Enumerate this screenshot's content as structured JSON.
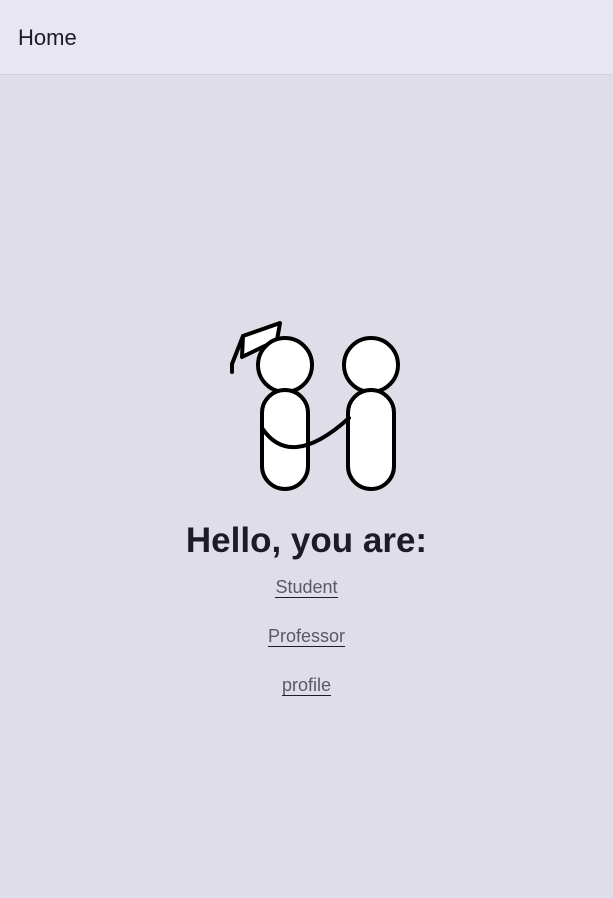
{
  "header": {
    "title": "Home"
  },
  "main": {
    "greeting": "Hello, you are:",
    "links": [
      {
        "label": "Student"
      },
      {
        "label": "Professor"
      },
      {
        "label": "profile"
      }
    ]
  },
  "colors": {
    "background": "#dfdee8",
    "header_background": "#e7e6f1",
    "text": "#1d1b26",
    "link_text": "#5a5866"
  },
  "icons": {
    "illustration": "student-professor-illustration-icon"
  }
}
